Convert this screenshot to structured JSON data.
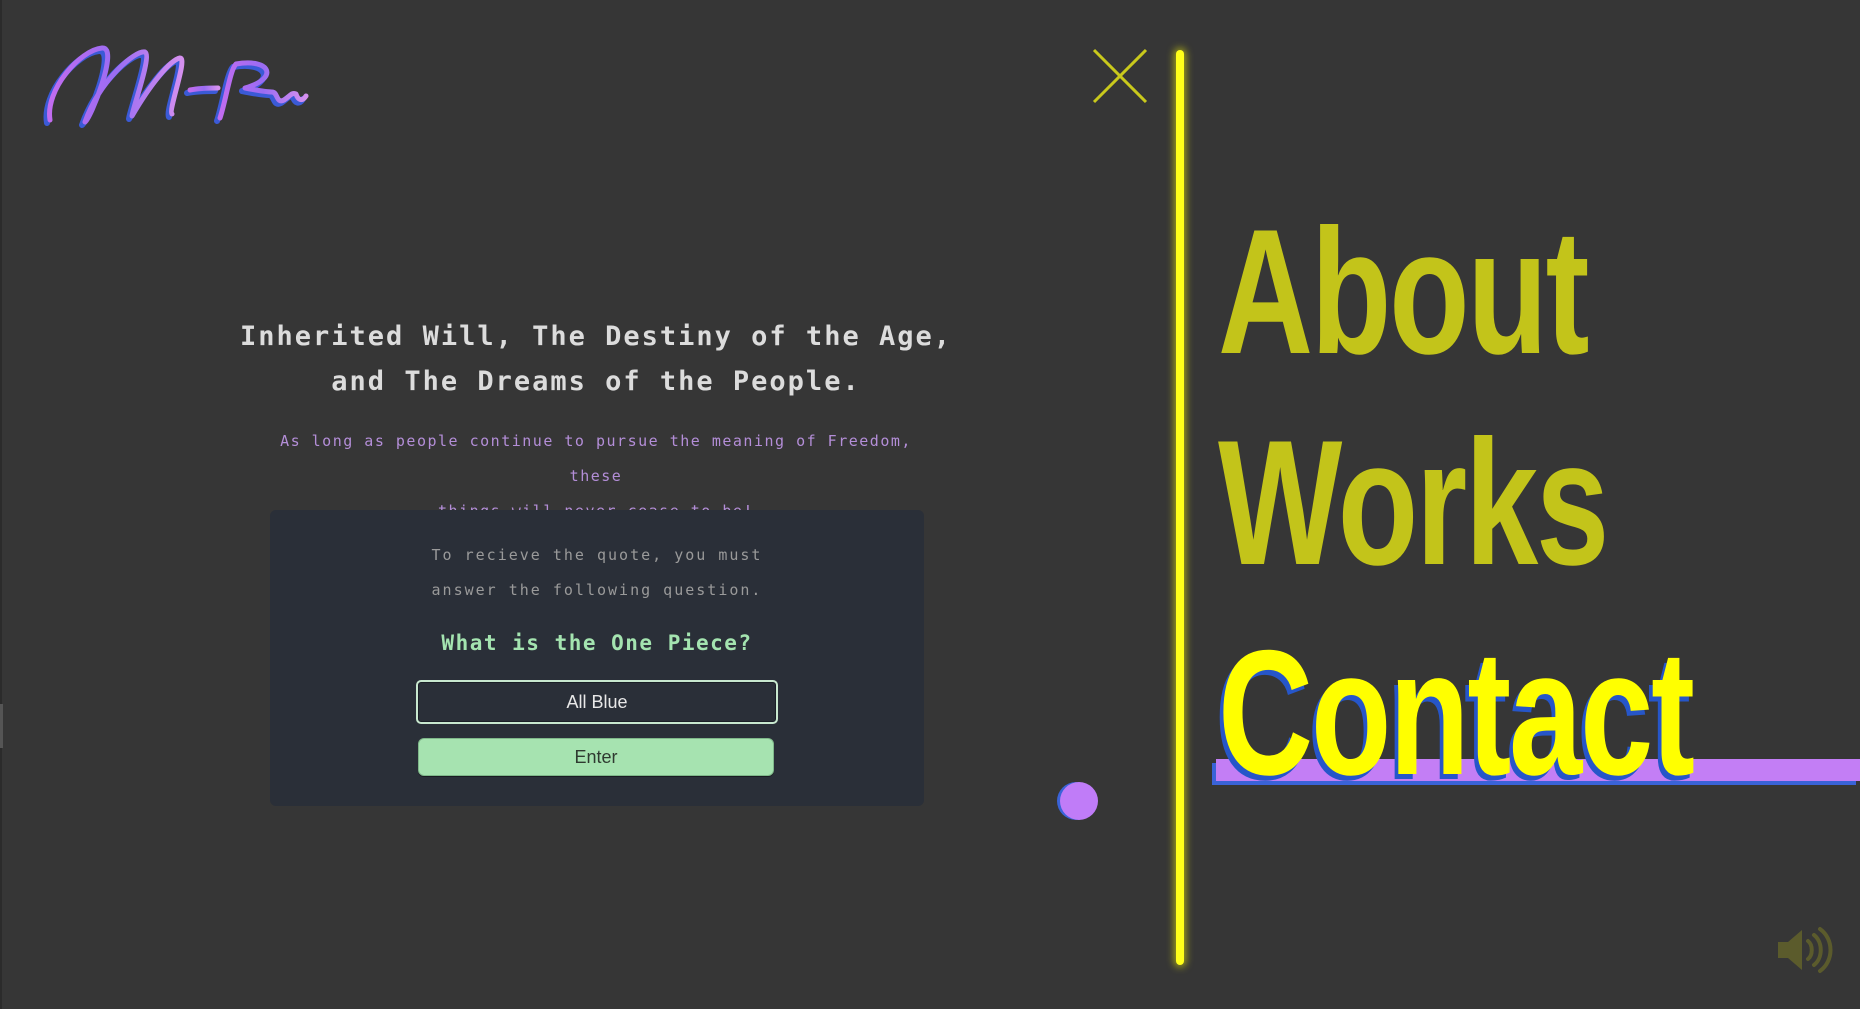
{
  "logo": {
    "text": "Mr Purple"
  },
  "headline": {
    "line1": "Inherited Will, The Destiny of the Age,",
    "line2": "and The Dreams of the People."
  },
  "subline": {
    "line1": "As long as people continue to pursue the meaning of Freedom, these",
    "line2": "things will never cease to be!"
  },
  "quiz": {
    "instruction_line1": "To recieve the quote, you must",
    "instruction_line2": "answer the following question.",
    "question": "What is the One Piece?",
    "input_value": "All Blue",
    "button_label": "Enter"
  },
  "nav": {
    "items": [
      {
        "label": "About"
      },
      {
        "label": "Works"
      },
      {
        "label": "Contact",
        "active": true
      }
    ]
  },
  "icons": {
    "close": "close-icon",
    "volume": "volume-icon",
    "logo": "logo-icon"
  },
  "colors": {
    "background": "#363636",
    "accent_yellow": "#ffff00",
    "nav_inactive": "#c3c41a",
    "accent_purple": "#c37ef5",
    "accent_blue": "#2656c9",
    "quiz_green": "#a6e3b0"
  }
}
